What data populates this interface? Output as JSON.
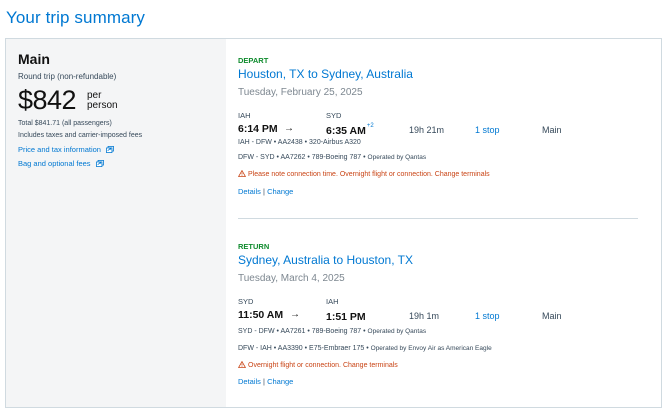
{
  "page_title": "Your trip summary",
  "summary": {
    "cabin": "Main",
    "trip_type": "Round trip (non-refundable)",
    "price": "$842",
    "per_line1": "per",
    "per_line2": "person",
    "total": "Total $841.71 (all passengers)",
    "includes": "Includes taxes and carrier-imposed fees",
    "price_tax_link": "Price and tax information",
    "bag_link": "Bag and optional fees"
  },
  "segments": [
    {
      "label": "DEPART",
      "route": "Houston, TX to Sydney, Australia",
      "date": "Tuesday, February 25, 2025",
      "origin": "IAH",
      "destination": "SYD",
      "depart_time": "6:14 PM",
      "arrow": "→",
      "arrive_time": "6:35 AM",
      "day_offset": "+2",
      "duration": "19h 21m",
      "stops": "1 stop",
      "cabin": "Main",
      "legs": [
        {
          "text": "IAH - DFW • AA2438 • 320-Airbus A320",
          "operated": ""
        },
        {
          "text": "DFW - SYD • AA7262 • 789-Boeing 787 •",
          "operated": "Operated by Qantas"
        }
      ],
      "warning": "Please note connection time. Overnight flight or connection. Change terminals",
      "details": "Details",
      "separator": "|",
      "change": "Change"
    },
    {
      "label": "RETURN",
      "route": "Sydney, Australia to Houston, TX",
      "date": "Tuesday, March 4, 2025",
      "origin": "SYD",
      "destination": "IAH",
      "depart_time": "11:50 AM",
      "arrow": "→",
      "arrive_time": "1:51 PM",
      "day_offset": "",
      "duration": "19h 1m",
      "stops": "1 stop",
      "cabin": "Main",
      "legs": [
        {
          "text": "SYD - DFW • AA7261 • 789-Boeing 787 •",
          "operated": "Operated by Qantas"
        },
        {
          "text": "DFW - IAH • AA3390 • E75-Embraer 175 •",
          "operated": "Operated by Envoy Air as American Eagle"
        }
      ],
      "warning": "Overnight flight or connection. Change terminals",
      "details": "Details",
      "separator": "|",
      "change": "Change"
    }
  ],
  "colors": {
    "brand_blue": "#0078d2",
    "depart_green": "#0f8b2d",
    "warning": "#c94415"
  }
}
